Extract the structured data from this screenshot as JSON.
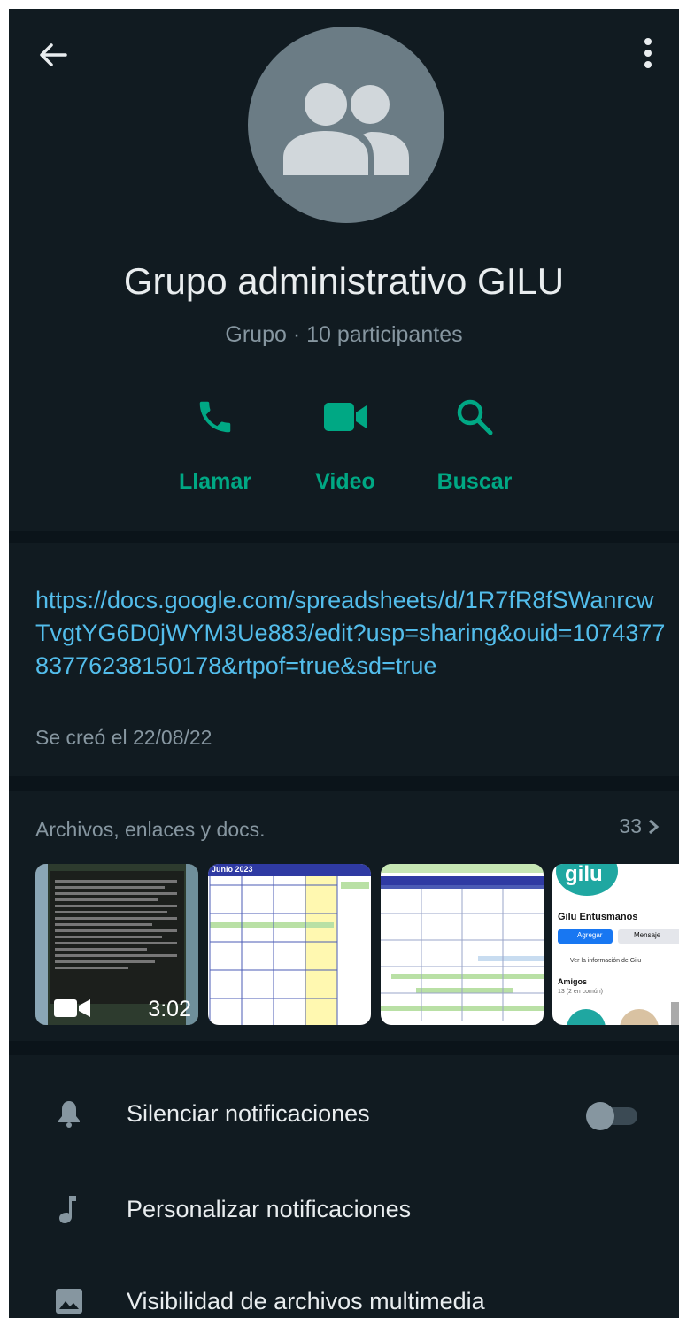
{
  "group": {
    "name": "Grupo administrativo GILU",
    "subtitle": "Grupo · 10 participantes"
  },
  "actions": [
    {
      "label": "Llamar",
      "icon": "phone-icon"
    },
    {
      "label": "Video",
      "icon": "video-icon"
    },
    {
      "label": "Buscar",
      "icon": "search-icon"
    }
  ],
  "description": {
    "link": "https://docs.google.com/spreadsheets/d/1R7fR8fSWanrcwTvgtYG6D0jWYM3Ue883/edit?usp=sharing&ouid=107437783776238150178&rtpof=true&sd=true",
    "created": "Se creó el 22/08/22"
  },
  "media": {
    "title": "Archivos, enlaces y docs.",
    "count": "33",
    "video_duration": "3:02",
    "thumb_contact_name": "Gilu Entusmanos",
    "thumb_add": "Agregar",
    "thumb_message": "Mensaje",
    "thumb_info": "Ver la información de Gilu",
    "thumb_friends": "Amigos",
    "thumb_friends_count": "13 (2 en común)",
    "thumb_logo": "gilu",
    "calendar_title": "Junio 2023"
  },
  "settings": [
    {
      "label": "Silenciar notificaciones",
      "icon": "bell-icon",
      "toggle": false
    },
    {
      "label": "Personalizar notificaciones",
      "icon": "music-note-icon"
    },
    {
      "label": "Visibilidad de archivos multimedia",
      "icon": "image-icon"
    }
  ],
  "colors": {
    "accent": "#00a884",
    "link": "#53bdeb",
    "background": "#111b21"
  }
}
